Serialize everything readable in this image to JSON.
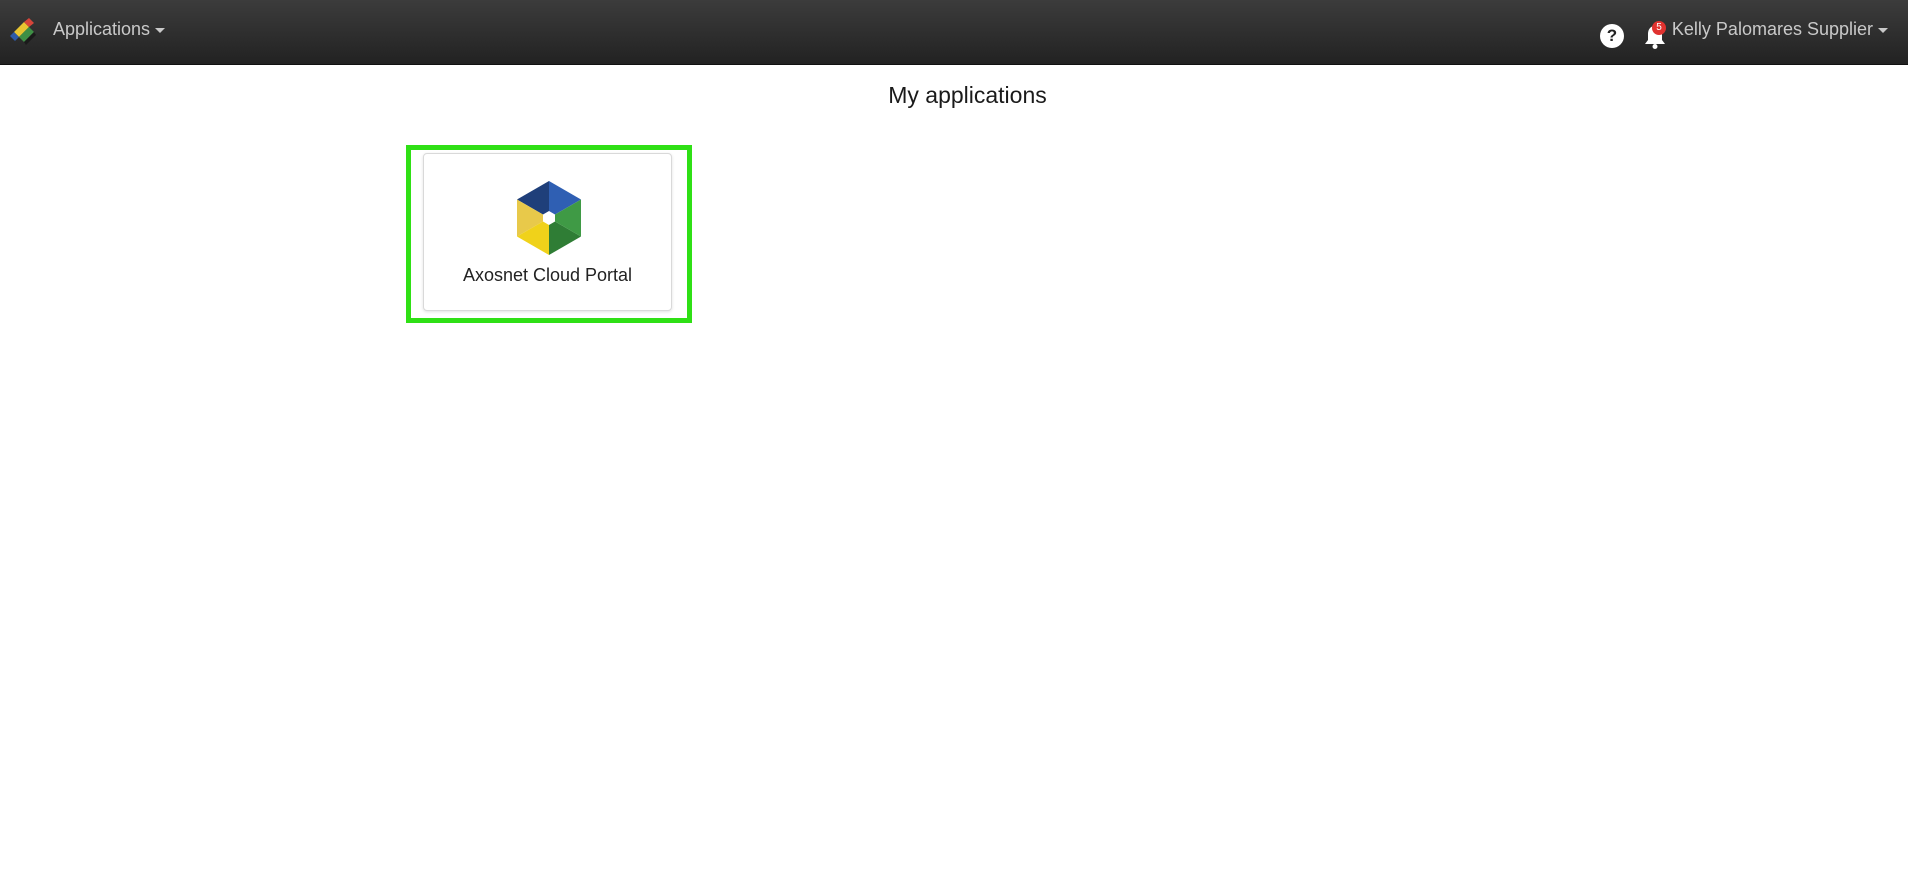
{
  "navbar": {
    "menu_label": "Applications",
    "help_label": "?",
    "notification_count": "5",
    "user_name": "Kelly Palomares Supplier"
  },
  "main": {
    "title": "My applications",
    "apps": [
      {
        "name": "Axosnet Cloud Portal",
        "icon": "axosnet-hexagon-icon",
        "selected": true
      }
    ]
  },
  "colors": {
    "navbar": "#2b2b2b",
    "highlight": "#2fe015",
    "badge": "#e0322f"
  }
}
